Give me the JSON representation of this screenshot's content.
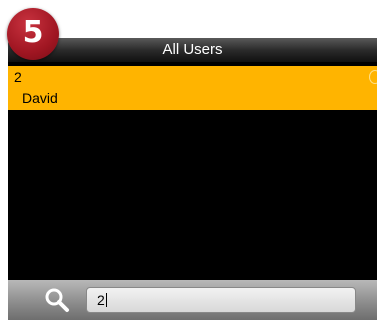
{
  "badge": {
    "number": "5"
  },
  "header": {
    "title": "All Users"
  },
  "users": [
    {
      "id": "2",
      "name": "David"
    }
  ],
  "search": {
    "value": "2"
  },
  "colors": {
    "selected_row": "#ffb400",
    "badge": "#a01622",
    "list_background": "#000000"
  }
}
